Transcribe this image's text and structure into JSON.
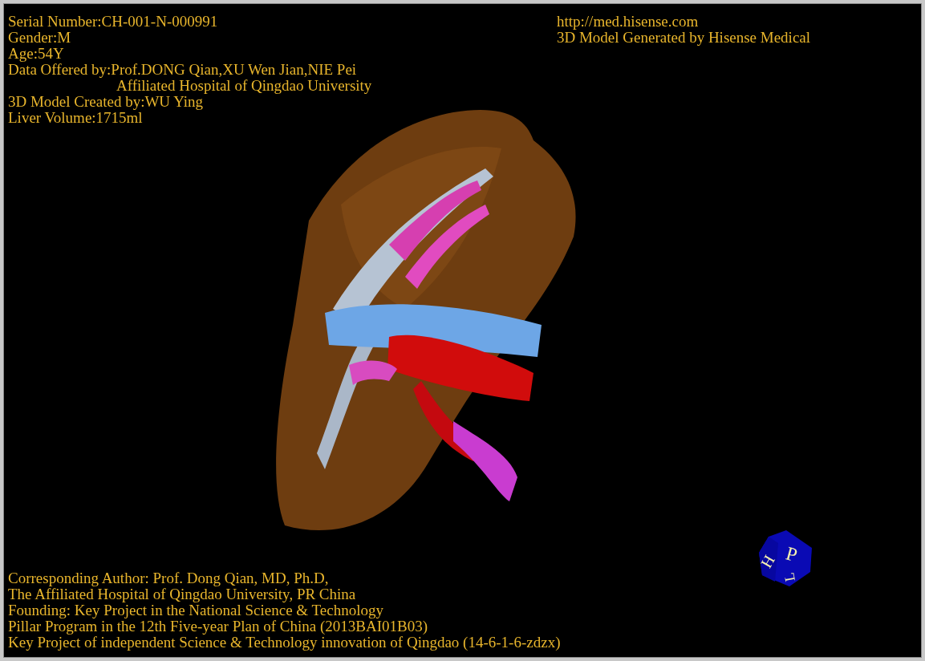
{
  "model_info": [
    "Serial Number:CH-001-N-000991",
    "Gender:M",
    "Age:54Y",
    "Data Offered by:Prof.DONG Qian,XU Wen Jian,NIE Pei"
  ],
  "model_info_indented": "Affiliated Hospital of Qingdao University",
  "model_info_more": [
    "3D Model Created by:WU Ying",
    "Liver Volume:1715ml"
  ],
  "website": "http://med.hisense.com",
  "generator": "3D Model Generated by Hisense Medical",
  "orientation_cube": {
    "faces": [
      "H",
      "P",
      "L"
    ]
  },
  "credits": [
    "Corresponding Author: Prof. Dong Qian, MD, Ph.D,",
    "The Affiliated Hospital of Qingdao University, PR China",
    "Founding: Key Project in the National Science & Technology",
    "Pillar Program in the 12th Five-year Plan of China (2013BAI01B03)",
    "Key Project of independent Science & Technology innovation of Qingdao (14-6-1-6-zdzx)"
  ]
}
